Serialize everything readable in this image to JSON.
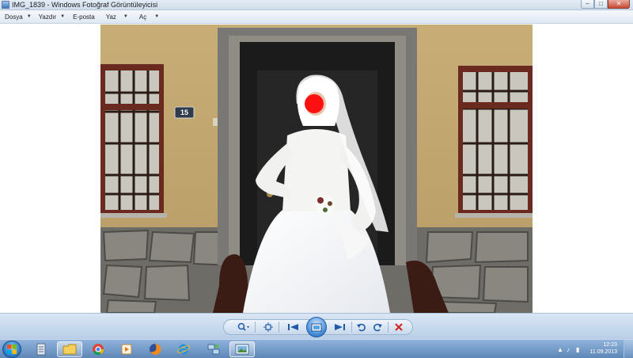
{
  "window": {
    "title": "IMG_1839 - Windows Fotoğraf Görüntüleyicisi",
    "minimize_icon": "minimize-icon",
    "maximize_icon": "maximize-icon",
    "close_icon": "close-icon"
  },
  "menu": {
    "items": [
      {
        "label": "Dosya"
      },
      {
        "label": "Yazdır"
      },
      {
        "label": "E-posta"
      },
      {
        "label": "Yaz"
      },
      {
        "label": "Aç"
      }
    ]
  },
  "photo": {
    "house_number": "15"
  },
  "toolbar": {
    "buttons": [
      "zoom-icon",
      "actual-size-icon",
      "previous-icon",
      "slideshow-icon",
      "next-icon",
      "rotate-left-icon",
      "rotate-right-icon",
      "delete-icon"
    ]
  },
  "taskbar": {
    "apps": [
      "start-orb",
      "library-icon",
      "explorer-icon",
      "chrome-icon",
      "media-player-icon",
      "firefox-icon",
      "internet-explorer-icon",
      "network-icon",
      "photo-viewer-icon"
    ],
    "clock_time": "12:23",
    "clock_date": "11.09.2013"
  },
  "colors": {
    "titlebar": "#dbe6f2",
    "toolbar": "#c6d8ed",
    "taskbar": "#6f96c6",
    "accent": "#1e5aa8"
  }
}
